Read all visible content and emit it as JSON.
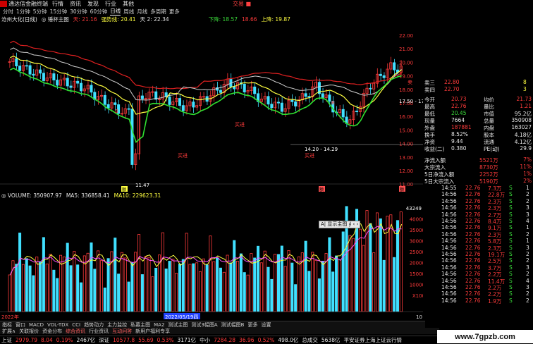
{
  "titlebar": {
    "app_title": "通达信金融终端",
    "menu": [
      "行情",
      "资讯",
      "发现",
      "行业",
      "其他"
    ],
    "warning": "交易 ■"
  },
  "periodbar": {
    "items": [
      "分时",
      "1分钟",
      "5分钟",
      "15分钟",
      "30分钟",
      "60分钟",
      "日线",
      "周线",
      "月线",
      "多周期",
      "更多"
    ],
    "selected": "日线"
  },
  "indicator_line": {
    "stock": "沧州大化(日线)",
    "formula": "◎ 锤杯主图",
    "sky": "天: 21.16",
    "strong": "强势线: 20.41",
    "sky2": "天 2: 22.34",
    "down": "下降: 18.57",
    "mid": "18.66",
    "up": "上降: 19.87"
  },
  "price_axis": [
    "22.00",
    "21.00",
    "20.00",
    "19.00",
    "18.00",
    "17.00",
    "16.00",
    "15.00",
    "14.00",
    "13.00",
    "12.00",
    "11.00"
  ],
  "annotations": {
    "low_label": "11.47",
    "range_label": "14.20 - 14.29",
    "range_label2": "17.50 - 17",
    "buy1": "买进",
    "buy2": "买进",
    "buy3": "买进",
    "sell1": "卖",
    "b1": "B",
    "b2": "B",
    "sig1": "额",
    "sig2": "额",
    "sig3": "额"
  },
  "volume_header": {
    "vol": "◎ VOLUME: 350907.97",
    "ma5": "MA5: 336858.41",
    "ma10": "MA10: 229623.31"
  },
  "volume_axis": [
    "43249",
    "40000",
    "35000",
    "30000",
    "25000",
    "20000",
    "15000",
    "10000",
    "X100"
  ],
  "volume_tooltip": "A| 显示主图 ∮ ‹ ›",
  "date_axis": {
    "left": "2022年",
    "mid": "2022/05/19四",
    "right": "10"
  },
  "tabs1": [
    "指标",
    "窗口",
    "MACD",
    "VOL-TDX",
    "CCI",
    "趋势动力",
    "主力监控",
    "私募主图",
    "MA2",
    "测试主图",
    "测试3幅图A",
    "测试幅图B",
    "更多",
    "设置"
  ],
  "tabs2": [
    "扩展∧",
    "关联报价",
    "资金分布",
    "综合资讯",
    "行业资讯",
    "互动问答",
    "新用户福利专享"
  ],
  "statusbar": {
    "sh_label": "上证",
    "sh_val": "2979.79",
    "sh_chg": "8.04",
    "sh_pct": "0.19%",
    "sh_amt": "2467亿",
    "sz_label": "深证",
    "sz_val": "10577.8",
    "sz_chg": "55.69",
    "sz_pct": "0.53%",
    "sz_amt": "3171亿",
    "zx_label": "中小",
    "zx_val": "7284.28",
    "zx_chg": "36.96",
    "zx_pct": "0.52%",
    "zx_amt": "498.0亿",
    "total_label": "总成交",
    "total_amt": "5638亿",
    "ticker": "平安证券上海上证云行情"
  },
  "quote": {
    "ask_rows": [
      {
        "label": "卖三",
        "price": "22.80",
        "vol": "8"
      },
      {
        "label": "卖四",
        "price": "22.70",
        "vol": "3"
      }
    ],
    "rows": [
      {
        "l1": "今开",
        "v1": "20.73",
        "l2": "均价",
        "v2": "21.73"
      },
      {
        "l1": "最高",
        "v1": "22.76",
        "l2": "量比",
        "v2": "1.21"
      },
      {
        "l1": "最低",
        "v1": "20.45",
        "l2": "市值",
        "v2": "95.2亿"
      },
      {
        "l1": "现量",
        "v1": "7664",
        "l2": "总量",
        "v2": "350908"
      },
      {
        "l1": "外盘",
        "v1": "187881",
        "l2": "内盘",
        "v2": "163027"
      },
      {
        "l1": "换手",
        "v1": "8.52%",
        "l2": "股本",
        "v2": "4.18亿"
      },
      {
        "l1": "净资",
        "v1": "9.44",
        "l2": "流通",
        "v2": "4.12亿"
      },
      {
        "l1": "收益(二)",
        "v1": "0.380",
        "l2": "PE(动)",
        "v2": "29.9"
      }
    ],
    "flows": [
      {
        "label": "净流入额",
        "val": "5521万",
        "pct": "7%"
      },
      {
        "label": "大宗流入",
        "val": "8730万",
        "pct": "11%"
      },
      {
        "label": "5日净流入额",
        "val": "2252万",
        "pct": "1%"
      },
      {
        "label": "5日大宗流入",
        "val": "5190万",
        "pct": "2%"
      }
    ]
  },
  "ticks": [
    {
      "t": "14:55",
      "p": "22.76",
      "v": "7.3万",
      "s": "S",
      "n": "1"
    },
    {
      "t": "14:56",
      "p": "22.76",
      "v": "22.8万",
      "s": "S",
      "n": "2"
    },
    {
      "t": "14:56",
      "p": "22.76",
      "v": "2.3万",
      "s": "S",
      "n": "2"
    },
    {
      "t": "14:56",
      "p": "22.76",
      "v": "2.3万",
      "s": "S",
      "n": "3"
    },
    {
      "t": "14:56",
      "p": "22.76",
      "v": "2.7万",
      "s": "S",
      "n": "3"
    },
    {
      "t": "14:56",
      "p": "22.76",
      "v": "8.4万",
      "s": "S",
      "n": "4"
    },
    {
      "t": "14:56",
      "p": "22.76",
      "v": "9.1万",
      "s": "S",
      "n": "1"
    },
    {
      "t": "14:56",
      "p": "22.76",
      "v": "2.3万",
      "s": "S",
      "n": "2"
    },
    {
      "t": "14:56",
      "p": "22.76",
      "v": "5.8万",
      "s": "S",
      "n": "1"
    },
    {
      "t": "14:56",
      "p": "22.76",
      "v": "2.3万",
      "s": "S",
      "n": "3"
    },
    {
      "t": "14:56",
      "p": "22.76",
      "v": "19.1万",
      "s": "S",
      "n": "2"
    },
    {
      "t": "14:56",
      "p": "22.76",
      "v": "2.5万",
      "s": "S",
      "n": "2"
    },
    {
      "t": "14:56",
      "p": "22.76",
      "v": "3.7万",
      "s": "S",
      "n": "3"
    },
    {
      "t": "14:56",
      "p": "22.76",
      "v": "2.2万",
      "s": "S",
      "n": "2"
    },
    {
      "t": "14:56",
      "p": "22.76",
      "v": "11.4万",
      "s": "S",
      "n": "4"
    },
    {
      "t": "14:56",
      "p": "22.76",
      "v": "2.2万",
      "s": "S",
      "n": "3"
    },
    {
      "t": "14:56",
      "p": "22.76",
      "v": "2.2万",
      "s": "S",
      "n": "2"
    },
    {
      "t": "14:56",
      "p": "22.76",
      "v": "1.9万",
      "s": "S",
      "n": "2"
    }
  ],
  "watermark": "www.7gpzb.com",
  "colors": {
    "up": "#ff3b3b",
    "down": "#3bdc3b",
    "flat": "#e8e8e8",
    "ma_yellow": "#ffff40",
    "ma_red": "#ff2020",
    "cyan": "#40e0ff"
  }
}
